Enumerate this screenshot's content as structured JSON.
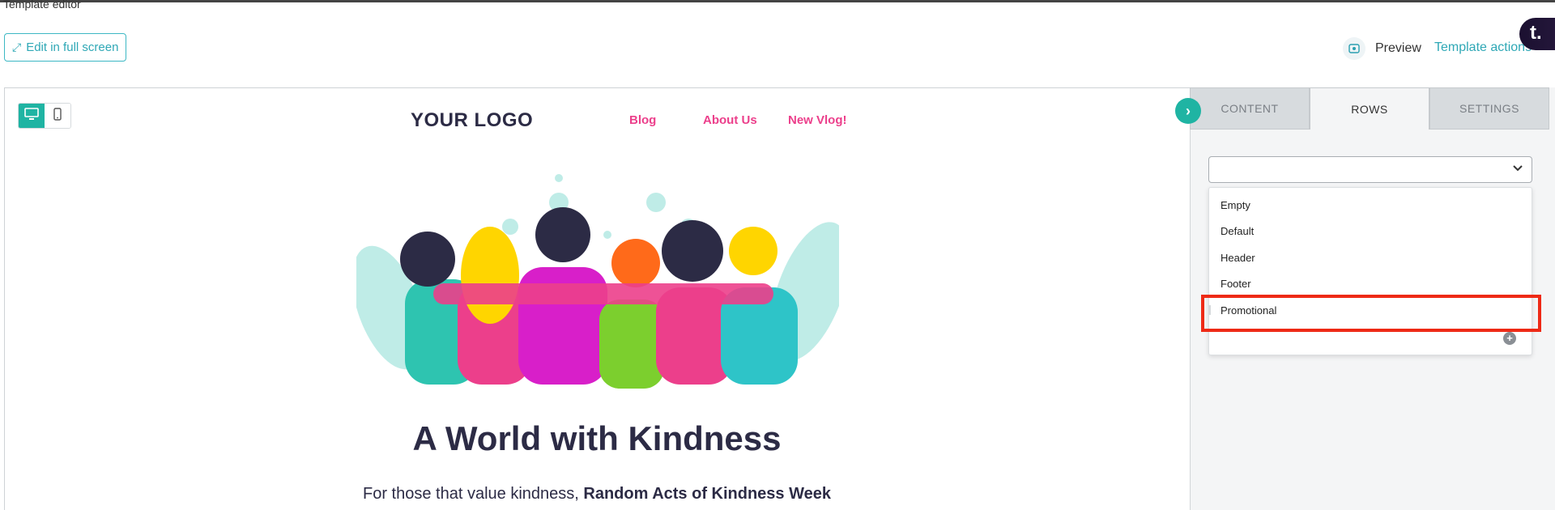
{
  "page": {
    "title": "Template editor"
  },
  "toolbar": {
    "fullscreen_label": "Edit in full screen",
    "preview_label": "Preview",
    "template_actions_label": "Template actions"
  },
  "brand": {
    "badge_text": "t."
  },
  "device_toggle": {
    "options": [
      "desktop-icon",
      "mobile-icon"
    ],
    "active": "desktop"
  },
  "email": {
    "logo": "YOUR LOGO",
    "nav": [
      "Blog",
      "About Us",
      "New Vlog!"
    ],
    "headline": "A World with Kindness",
    "body_prefix": "For those that value kindness, ",
    "body_bold": "Random Acts of Kindness Week"
  },
  "sidebar": {
    "tabs": [
      "CONTENT",
      "ROWS",
      "SETTINGS"
    ],
    "active_tab": "ROWS",
    "select_value": "",
    "dropdown_options": [
      "Empty",
      "Default",
      "Header",
      "Footer",
      "Promotional"
    ],
    "highlighted_option": "Promotional"
  },
  "colors": {
    "accent_teal": "#1fb4a3",
    "link_teal": "#2fa8b6",
    "nav_pink": "#ec3f8b",
    "heading_navy": "#2c2b45",
    "highlight_red": "#ee2a16"
  }
}
